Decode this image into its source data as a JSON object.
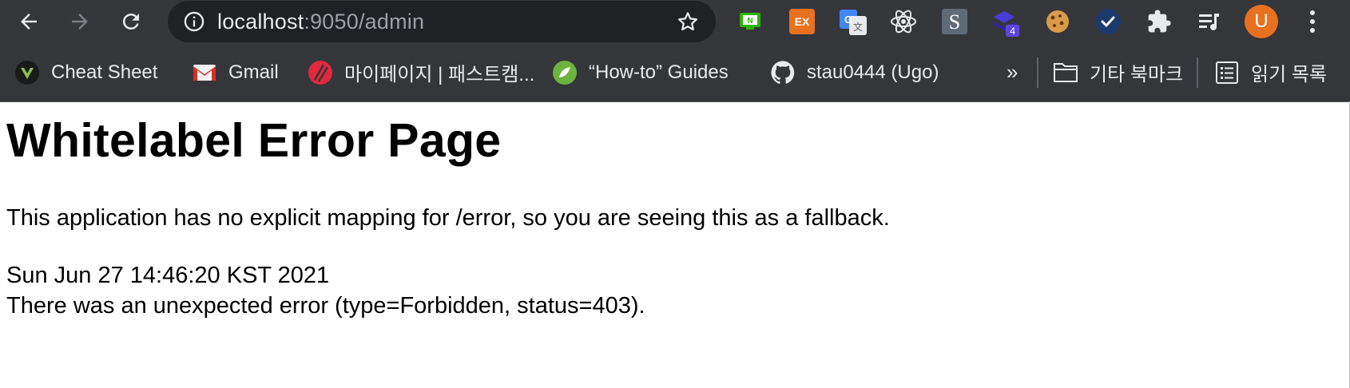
{
  "browser": {
    "url_host": "localhost",
    "url_rest": ":9050/admin",
    "avatar_letter": "U",
    "ext_badge_count": "4",
    "ext_ex_label": "EX",
    "ext_n_label": "N",
    "ext_s_label": "S"
  },
  "bookmarks": {
    "items": [
      {
        "label": "Cheat Sheet"
      },
      {
        "label": "Gmail"
      },
      {
        "label": "마이페이지 | 패스트캠..."
      },
      {
        "label": "“How-to” Guides"
      },
      {
        "label": "stau0444 (Ugo)"
      }
    ],
    "overflow": "»",
    "other_bookmarks": "기타 북마크",
    "reading_list": "읽기 목록"
  },
  "page": {
    "title": "Whitelabel Error Page",
    "message": "This application has no explicit mapping for /error, so you are seeing this as a fallback.",
    "timestamp": "Sun Jun 27 14:46:20 KST 2021",
    "error": "There was an unexpected error (type=Forbidden, status=403)."
  },
  "colors": {
    "toolbar_bg": "#35363a",
    "omnibox_bg": "#202124",
    "avatar_bg": "#e8711f"
  }
}
